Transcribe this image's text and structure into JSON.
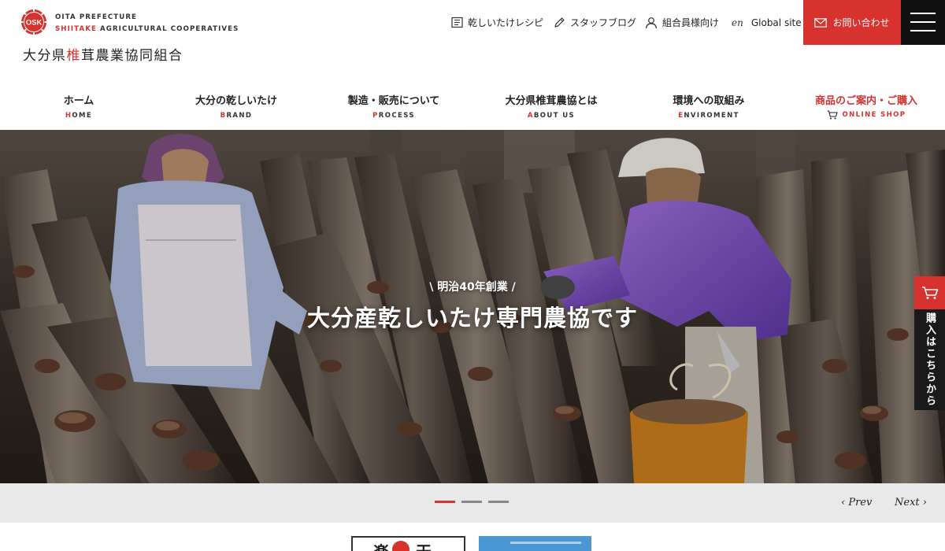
{
  "logo": {
    "mark_text": "OSK",
    "en_line1": "OITA PREFECTURE",
    "en_line2_accent": "SHIITAKE",
    "en_line2_rest": " AGRICULTURAL COOPERATIVES",
    "jp_part1": "大分県",
    "jp_accent": "椎",
    "jp_part2": "茸農業協同組合"
  },
  "utility_nav": {
    "recipe": "乾しいたけレシピ",
    "blog": "スタッフブログ",
    "members": "組合員様向け",
    "global_prefix": "en",
    "global": "Global site",
    "contact": "お問い合わせ"
  },
  "main_nav": [
    {
      "jp": "ホーム",
      "en_first": "H",
      "en_rest": "OME"
    },
    {
      "jp": "大分の乾しいたけ",
      "en_first": "B",
      "en_rest": "RAND"
    },
    {
      "jp": "製造・販売について",
      "en_first": "P",
      "en_rest": "ROCESS"
    },
    {
      "jp": "大分県椎茸農協とは",
      "en_first": "A",
      "en_rest": "BOUT US"
    },
    {
      "jp": "環境への取組み",
      "en_first": "E",
      "en_rest": "NVIROMENT"
    },
    {
      "jp": "商品のご案内・ご購入",
      "en": "ONLINE SHOP"
    }
  ],
  "hero": {
    "kicker": "\\ 明治40年創業 /",
    "title": "大分産乾しいたけ専門農協です",
    "slide_count": 3,
    "active_slide": 1
  },
  "side_tab": {
    "label": "購入はこちらから"
  },
  "slider": {
    "prev": "‹ Prev",
    "next": "Next ›"
  },
  "banners": {
    "banner1_text_a": "楽",
    "banner1_text_b": "天"
  },
  "colors": {
    "accent": "#d7322e",
    "dark": "#111111",
    "slider_bg": "#e9e9e9"
  }
}
